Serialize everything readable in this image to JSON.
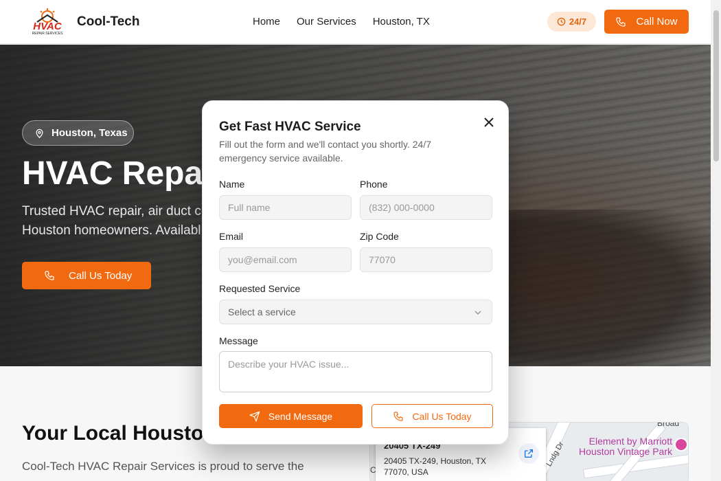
{
  "header": {
    "brand": "Cool-Tech",
    "logo_text": "HVAC",
    "logo_subtext": "REPAIR SERVICES",
    "nav": [
      "Home",
      "Our Services",
      "Houston, TX"
    ],
    "badge": "24/7",
    "call_now": "Call Now"
  },
  "hero": {
    "location": "Houston, Texas",
    "title": "HVAC Repair",
    "subtitle": "Trusted HVAC repair, air duct c",
    "subtitle_line2": "Houston homeowners. Availabl",
    "cta": "Call Us Today"
  },
  "section": {
    "title": "Your Local Houston",
    "text": "Cool-Tech HVAC Repair Services is proud to serve the"
  },
  "map": {
    "address_top": "20405 TX-249",
    "address": "20405 TX-249, Houston, TX 77070, USA",
    "poi": "Element by Marriott Houston Vintage Park",
    "street": "Lndg Dr",
    "street2": "Broad",
    "edge_letter": "C"
  },
  "modal": {
    "title": "Get Fast HVAC Service",
    "description": "Fill out the form and we'll contact you shortly. 24/7 emergency service available.",
    "name_label": "Name",
    "name_placeholder": "Full name",
    "phone_label": "Phone",
    "phone_placeholder": "(832) 000-0000",
    "email_label": "Email",
    "email_placeholder": "you@email.com",
    "zip_label": "Zip Code",
    "zip_placeholder": "77070",
    "service_label": "Requested Service",
    "service_value": "Select a service",
    "message_label": "Message",
    "message_placeholder": "Describe your HVAC issue...",
    "send": "Send Message",
    "call": "Call Us Today"
  },
  "colors": {
    "accent": "#f26a10",
    "badge_bg": "#fde8d8"
  }
}
